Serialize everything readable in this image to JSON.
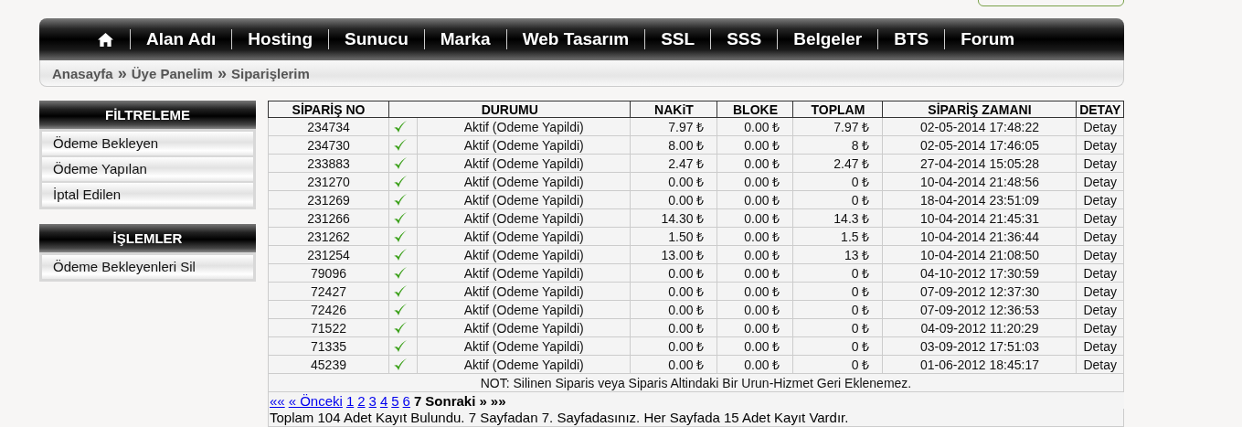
{
  "nav": {
    "items": [
      {
        "kind": "home"
      },
      {
        "kind": "text",
        "label": "Alan Adı"
      },
      {
        "kind": "text",
        "label": "Hosting"
      },
      {
        "kind": "text",
        "label": "Sunucu"
      },
      {
        "kind": "text",
        "label": "Marka"
      },
      {
        "kind": "text",
        "label": "Web Tasarım"
      },
      {
        "kind": "text",
        "label": "SSL"
      },
      {
        "kind": "text",
        "label": "SSS"
      },
      {
        "kind": "text",
        "label": "Belgeler"
      },
      {
        "kind": "text",
        "label": "BTS"
      },
      {
        "kind": "text",
        "label": "Forum"
      }
    ]
  },
  "breadcrumb": [
    "Anasayfa",
    "Üye Panelim",
    "Siparişlerim"
  ],
  "breadcrumb_separator": "»",
  "sidebar": [
    {
      "title": "FİLTRELEME",
      "items": [
        "Ödeme Bekleyen",
        "Ödeme Yapılan",
        "İptal Edilen"
      ]
    },
    {
      "title": "İŞLEMLER",
      "items": [
        "Ödeme Bekleyenleri Sil"
      ]
    }
  ],
  "table": {
    "columns": [
      "SİPARİŞ NO",
      "DURUMU",
      "NAKiT",
      "BLOKE",
      "TOPLAM",
      "SİPARİŞ ZAMANI",
      "DETAY"
    ],
    "rows": [
      {
        "no": "234734",
        "ok": true,
        "status": "Aktif (Odeme Yapildi)",
        "cash": "7.97 ₺",
        "blocked": "0.00 ₺",
        "total": "7.97 ₺",
        "time": "02-05-2014 17:48:22",
        "detail": "Detay"
      },
      {
        "no": "234730",
        "ok": true,
        "status": "Aktif (Odeme Yapildi)",
        "cash": "8.00 ₺",
        "blocked": "0.00 ₺",
        "total": "8 ₺",
        "time": "02-05-2014 17:46:05",
        "detail": "Detay"
      },
      {
        "no": "233883",
        "ok": true,
        "status": "Aktif (Odeme Yapildi)",
        "cash": "2.47 ₺",
        "blocked": "0.00 ₺",
        "total": "2.47 ₺",
        "time": "27-04-2014 15:05:28",
        "detail": "Detay"
      },
      {
        "no": "231270",
        "ok": true,
        "status": "Aktif (Odeme Yapildi)",
        "cash": "0.00 ₺",
        "blocked": "0.00 ₺",
        "total": "0 ₺",
        "time": "10-04-2014 21:48:56",
        "detail": "Detay"
      },
      {
        "no": "231269",
        "ok": true,
        "status": "Aktif (Odeme Yapildi)",
        "cash": "0.00 ₺",
        "blocked": "0.00 ₺",
        "total": "0 ₺",
        "time": "18-04-2014 23:51:09",
        "detail": "Detay"
      },
      {
        "no": "231266",
        "ok": true,
        "status": "Aktif (Odeme Yapildi)",
        "cash": "14.30 ₺",
        "blocked": "0.00 ₺",
        "total": "14.3 ₺",
        "time": "10-04-2014 21:45:31",
        "detail": "Detay"
      },
      {
        "no": "231262",
        "ok": true,
        "status": "Aktif (Odeme Yapildi)",
        "cash": "1.50 ₺",
        "blocked": "0.00 ₺",
        "total": "1.5 ₺",
        "time": "10-04-2014 21:36:44",
        "detail": "Detay"
      },
      {
        "no": "231254",
        "ok": true,
        "status": "Aktif (Odeme Yapildi)",
        "cash": "13.00 ₺",
        "blocked": "0.00 ₺",
        "total": "13 ₺",
        "time": "10-04-2014 21:08:50",
        "detail": "Detay"
      },
      {
        "no": "79096",
        "ok": true,
        "status": "Aktif (Odeme Yapildi)",
        "cash": "0.00 ₺",
        "blocked": "0.00 ₺",
        "total": "0 ₺",
        "time": "04-10-2012 17:30:59",
        "detail": "Detay"
      },
      {
        "no": "72427",
        "ok": true,
        "status": "Aktif (Odeme Yapildi)",
        "cash": "0.00 ₺",
        "blocked": "0.00 ₺",
        "total": "0 ₺",
        "time": "07-09-2012 12:37:30",
        "detail": "Detay"
      },
      {
        "no": "72426",
        "ok": true,
        "status": "Aktif (Odeme Yapildi)",
        "cash": "0.00 ₺",
        "blocked": "0.00 ₺",
        "total": "0 ₺",
        "time": "07-09-2012 12:36:53",
        "detail": "Detay"
      },
      {
        "no": "71522",
        "ok": true,
        "status": "Aktif (Odeme Yapildi)",
        "cash": "0.00 ₺",
        "blocked": "0.00 ₺",
        "total": "0 ₺",
        "time": "04-09-2012 11:20:29",
        "detail": "Detay"
      },
      {
        "no": "71335",
        "ok": true,
        "status": "Aktif (Odeme Yapildi)",
        "cash": "0.00 ₺",
        "blocked": "0.00 ₺",
        "total": "0 ₺",
        "time": "03-09-2012 17:51:03",
        "detail": "Detay"
      },
      {
        "no": "45239",
        "ok": true,
        "status": "Aktif (Odeme Yapildi)",
        "cash": "0.00 ₺",
        "blocked": "0.00 ₺",
        "total": "0 ₺",
        "time": "01-06-2012 18:45:17",
        "detail": "Detay"
      }
    ],
    "note": "NOT: Silinen Siparis veya Siparis Altindaki Bir Urun-Hizmet Geri Eklenemez."
  },
  "pagination": {
    "first": {
      "label": "««",
      "disabled": false
    },
    "prev": {
      "label": "« Önceki",
      "disabled": false
    },
    "pages": [
      {
        "label": "1",
        "selected": false
      },
      {
        "label": "2",
        "selected": false
      },
      {
        "label": "3",
        "selected": false
      },
      {
        "label": "4",
        "selected": false
      },
      {
        "label": "5",
        "selected": false
      },
      {
        "label": "6",
        "selected": false
      },
      {
        "label": "7",
        "selected": true
      }
    ],
    "next": {
      "label": "Sonraki »",
      "disabled": true
    },
    "last": {
      "label": "»»",
      "disabled": true
    }
  },
  "summary": "Toplam 104 Adet Kayıt Bulundu. 7 Sayfadan 7. Sayfadasınız. Her Sayfada 15 Adet Kayıt Vardır."
}
